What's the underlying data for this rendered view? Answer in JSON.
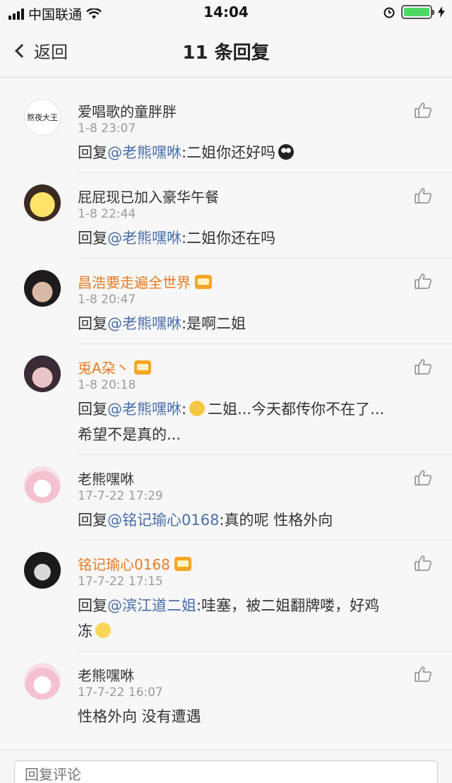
{
  "status_bar": {
    "carrier": "中国联通",
    "time": "14:04"
  },
  "nav": {
    "back_label": "返回",
    "title": "11 条回复"
  },
  "comments": [
    {
      "name": "爱唱歌的童胖胖",
      "avatar_text": "熬夜大王",
      "time": "1-8 23:07",
      "prefix": "回复",
      "mention": "@老熊嘿咻",
      "text": ":二姐你还好吗",
      "text2": ""
    },
    {
      "name": "屁屁现已加入豪华午餐",
      "avatar_text": "",
      "time": "1-8 22:44",
      "prefix": "回复",
      "mention": "@老熊嘿咻",
      "text": ":二姐你还在吗",
      "text2": ""
    },
    {
      "name": "昌浩要走遍全世界",
      "avatar_text": "",
      "time": "1-8 20:47",
      "prefix": "回复",
      "mention": "@老熊嘿咻",
      "text": ":是啊二姐",
      "text2": ""
    },
    {
      "name": "兎A朶丶",
      "avatar_text": "",
      "time": "1-8 20:18",
      "prefix": "回复",
      "mention": "@老熊嘿咻",
      "text": "二姐...今天都传你不在了...",
      "text2": "希望不是真的..."
    },
    {
      "name": "老熊嘿咻",
      "avatar_text": "",
      "time": "17-7-22 17:29",
      "prefix": "回复",
      "mention": "@铭记瑜心0168",
      "text": ":真的呢 性格外向",
      "text2": ""
    },
    {
      "name": "铭记瑜心0168",
      "avatar_text": "",
      "time": "17-7-22 17:15",
      "prefix": "回复",
      "mention": "@滨江道二姐",
      "text": ":哇塞，被二姐翻牌喽，好鸡",
      "text2": "冻"
    },
    {
      "name": "老熊嘿咻",
      "avatar_text": "",
      "time": "17-7-22 16:07",
      "prefix": "",
      "mention": "",
      "text": "性格外向 没有遭遇",
      "text2": ""
    }
  ],
  "reply_box": {
    "placeholder": "回复评论"
  }
}
